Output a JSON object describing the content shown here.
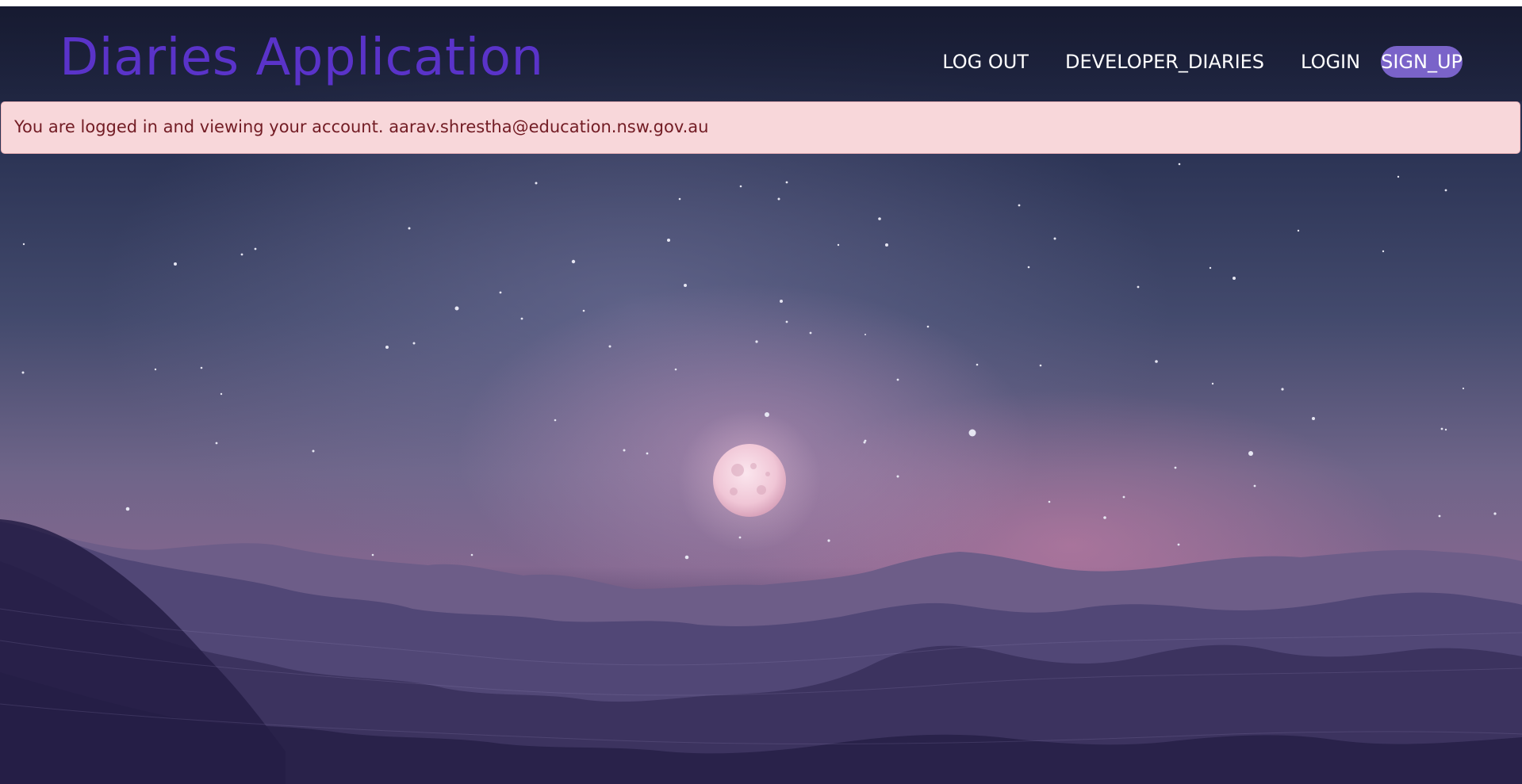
{
  "brand": {
    "title": "Diaries Application"
  },
  "nav": {
    "items": [
      {
        "label": "LOG OUT"
      },
      {
        "label": "DEVELOPER_DIARIES"
      },
      {
        "label": "LOGIN"
      },
      {
        "label": "SIGN_UP"
      }
    ]
  },
  "alert": {
    "message": "You are logged in and viewing your account. aarav.shrestha@education.nsw.gov.au"
  },
  "colors": {
    "brand": "#5a33c9",
    "pill": "#7a63c9",
    "alert_bg": "#f8d7da",
    "alert_text": "#721c24"
  }
}
